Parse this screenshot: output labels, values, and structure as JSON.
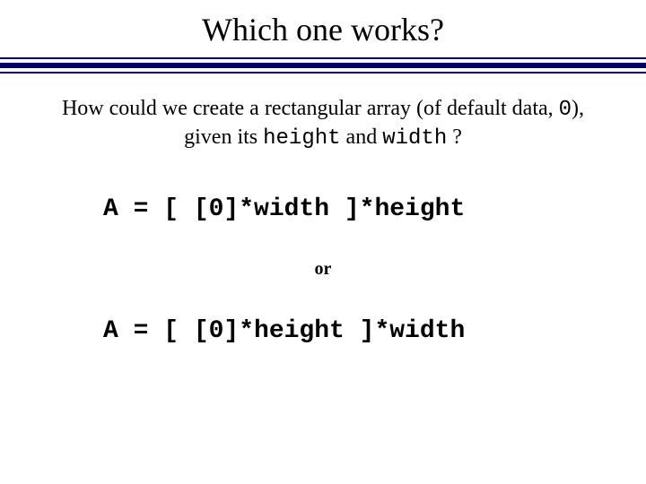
{
  "title": "Which one works?",
  "question": {
    "line1_prefix": "How could we create a rectangular array (of default data, ",
    "zero": "0",
    "line1_suffix": "),",
    "line2_prefix": "given its ",
    "height_word": "height",
    "and_word": " and ",
    "width_word": "width",
    "line2_suffix": " ?"
  },
  "code1": "A = [ [0]*width ]*height",
  "or_label": "or",
  "code2": "A = [ [0]*height ]*width"
}
